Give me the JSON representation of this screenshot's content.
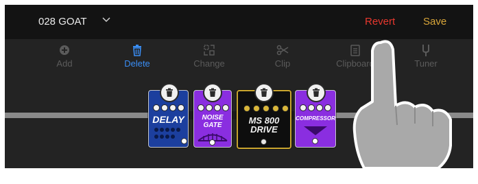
{
  "header": {
    "preset_name": "028 GOAT",
    "revert_label": "Revert",
    "save_label": "Save"
  },
  "toolbar": {
    "items": [
      {
        "label": "Add",
        "icon": "plus-circle-icon",
        "active": false
      },
      {
        "label": "Delete",
        "icon": "trash-icon",
        "active": true
      },
      {
        "label": "Change",
        "icon": "swap-icon",
        "active": false
      },
      {
        "label": "Clip",
        "icon": "scissors-icon",
        "active": false
      },
      {
        "label": "Clipboard",
        "icon": "clipboard-icon",
        "active": false
      },
      {
        "label": "Tuner",
        "icon": "tuning-fork-icon",
        "active": false
      }
    ]
  },
  "pedals": [
    {
      "label": "DELAY",
      "color": "#1c3f9e"
    },
    {
      "label": "NOISE GATE",
      "line1": "NOISE",
      "line2": "GATE",
      "color": "#8a2ee0"
    },
    {
      "label": "MS 800 DRIVE",
      "line1": "MS 800",
      "line2": "DRIVE",
      "color": "#0e0e0e"
    },
    {
      "label": "COMPRESSOR",
      "color": "#8a2ee0"
    }
  ],
  "colors": {
    "revert": "#e8382e",
    "save": "#d9a63a",
    "active_tool": "#3a8ef5"
  }
}
